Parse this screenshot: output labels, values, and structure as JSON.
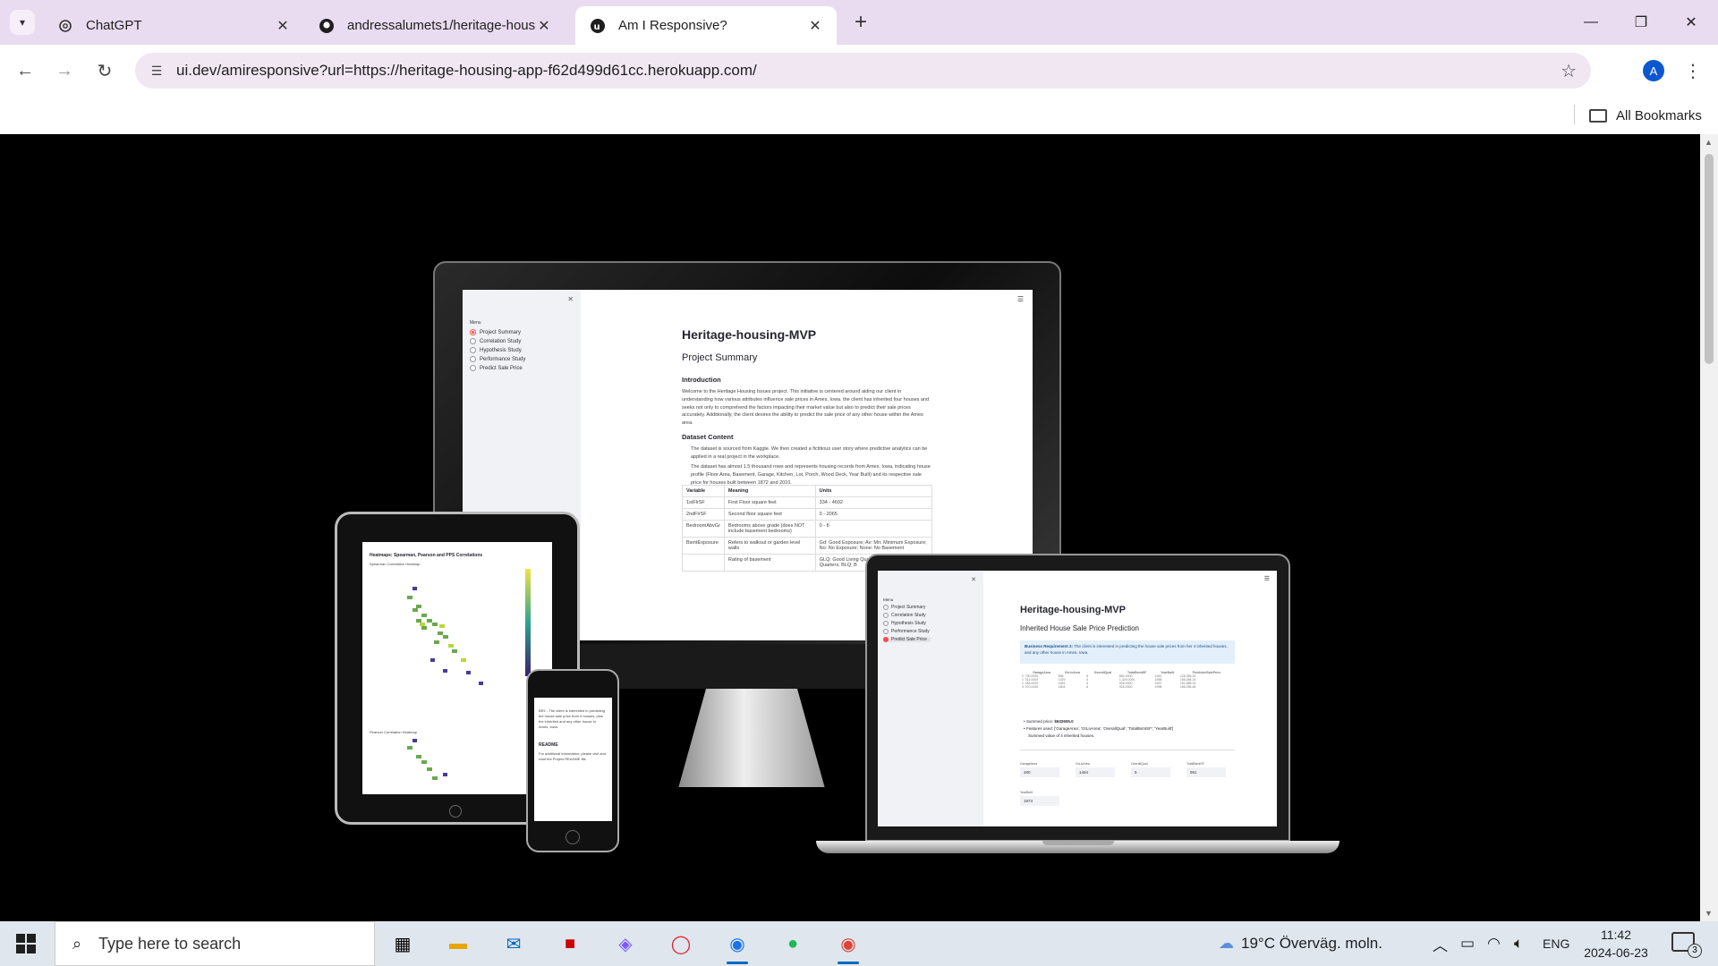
{
  "tabs": [
    {
      "title": "ChatGPT",
      "icon": "chatgpt-icon",
      "active": false
    },
    {
      "title": "andressalumets1/heritage-hous",
      "icon": "github-icon",
      "active": false
    },
    {
      "title": "Am I Responsive?",
      "icon": "amiresponsive-icon",
      "active": true
    }
  ],
  "toolbar": {
    "url": "ui.dev/amiresponsive?url=https://heritage-housing-app-f62d499d61cc.herokuapp.com/",
    "profile_initial": "A"
  },
  "bookmarks": {
    "all_label": "All Bookmarks"
  },
  "monitor_app": {
    "sidebar": {
      "menu_label": "Menu",
      "items": [
        "Project Summary",
        "Correlation Study",
        "Hypothesis Study",
        "Performance Study",
        "Predict Sale Price"
      ],
      "selected_index": 0
    },
    "title": "Heritage-housing-MVP",
    "subtitle": "Project Summary",
    "intro_heading": "Introduction",
    "intro_text": "Welcome to the Heritage Housing Issues project. This initiative is centered around aiding our client in understanding how various attributes influence sale prices in Ames, Iowa. the client has inherited four houses and seeks not only to comprehend the factors impacting their market value but also to predict their sale prices accurately. Additionally, the client desires the ability to predict the sale price of any other house within the Ames area.",
    "dataset_heading": "Dataset Content",
    "bullets": [
      "The dataset is sourced from Kaggle. We then created a fictitious user story where predictive analytics can be applied in a real project in the workplace.",
      "The dataset has almost 1.5 thousand rows and represents housing records from Ames, Iowa, indicating house profile (Floor Area, Basement, Garage, Kitchen, Lot, Porch, Wood Deck, Year Built) and its respective sale price for houses built between 1872 and 2010."
    ],
    "table": {
      "headers": [
        "Variable",
        "Meaning",
        "Units"
      ],
      "rows": [
        [
          "1stFlrSF",
          "First Floor square feet",
          "334 - 4692"
        ],
        [
          "2ndFlrSF",
          "Second floor square feet",
          "0 - 2065"
        ],
        [
          "BedroomAbvGr",
          "Bedrooms above grade (does NOT include basement bedrooms)",
          "0 - 8"
        ],
        [
          "BsmtExposure",
          "Refers to walkout or garden level walls",
          "Gd: Good Exposure; Av: Mn: Minimum Exposure; No: No Exposure; None: No Basement"
        ],
        [
          "",
          "Rating of basement",
          "GLQ: Good Living Quarters; ALQ: Average Living Quarters; BLQ: B"
        ]
      ]
    }
  },
  "tablet_app": {
    "title": "Heatmaps: Spearman, Pearson and PPS Correlations",
    "sub1": "Spearman Correlation Heatmap",
    "sub2": "Pearson Correlation Heatmap"
  },
  "phone_app": {
    "line1": "BR2 - The client is interested in predicting the house sale price from 4 houses, plus the inherited and any other house in Ames, Iowa.",
    "heading": "README",
    "line2": "For additional information, please visit and read the Project README file."
  },
  "laptop_app": {
    "title": "Heritage-housing-MVP",
    "subtitle": "Inherited House Sale Price Prediction",
    "business_label": "Business Requirement 2:",
    "business_text": "The client is interested in predicting the house sale prices from her 4 inherited houses, and any other house in Ames, Iowa.",
    "summed_label": "Summed price: ",
    "summed_value": "$632605.0",
    "features_text": "Features used: ['GarageArea', 'GrLivArea', 'OverallQual', 'TotalBsmtSF', 'YearBuilt']",
    "summed_note": "Summed value of 4 inherited houses.",
    "table_headers": [
      "GarageArea",
      "GrLivArea",
      "OverallQual",
      "TotalBsmtSF",
      "YearBuilt",
      "PredictedSalePrice"
    ],
    "table_rows": [
      [
        "0",
        "730.0000",
        "896",
        "5",
        "882.0000",
        "1961",
        "128,359.29"
      ],
      [
        "1",
        "312.0000",
        "1329",
        "6",
        "1,329.0000",
        "1958",
        "156,084.24"
      ],
      [
        "2",
        "482.0000",
        "1629",
        "5",
        "928.0000",
        "1997",
        "161,885.03"
      ],
      [
        "3",
        "470.0000",
        "1604",
        "6",
        "926.0000",
        "1998",
        "186,256.46"
      ]
    ],
    "inputs": [
      {
        "label": "GarageArea",
        "value": "480"
      },
      {
        "label": "GrLivArea",
        "value": "1464"
      },
      {
        "label": "OverallQual",
        "value": "5"
      },
      {
        "label": "TotalBsmtSF",
        "value": "991"
      },
      {
        "label": "YearBuilt",
        "value": "1973"
      }
    ]
  },
  "taskbar": {
    "search_placeholder": "Type here to search",
    "weather": "19°C  Överväg. moln.",
    "language": "ENG",
    "time": "11:42",
    "date": "2024-06-23",
    "notifications": "3"
  }
}
